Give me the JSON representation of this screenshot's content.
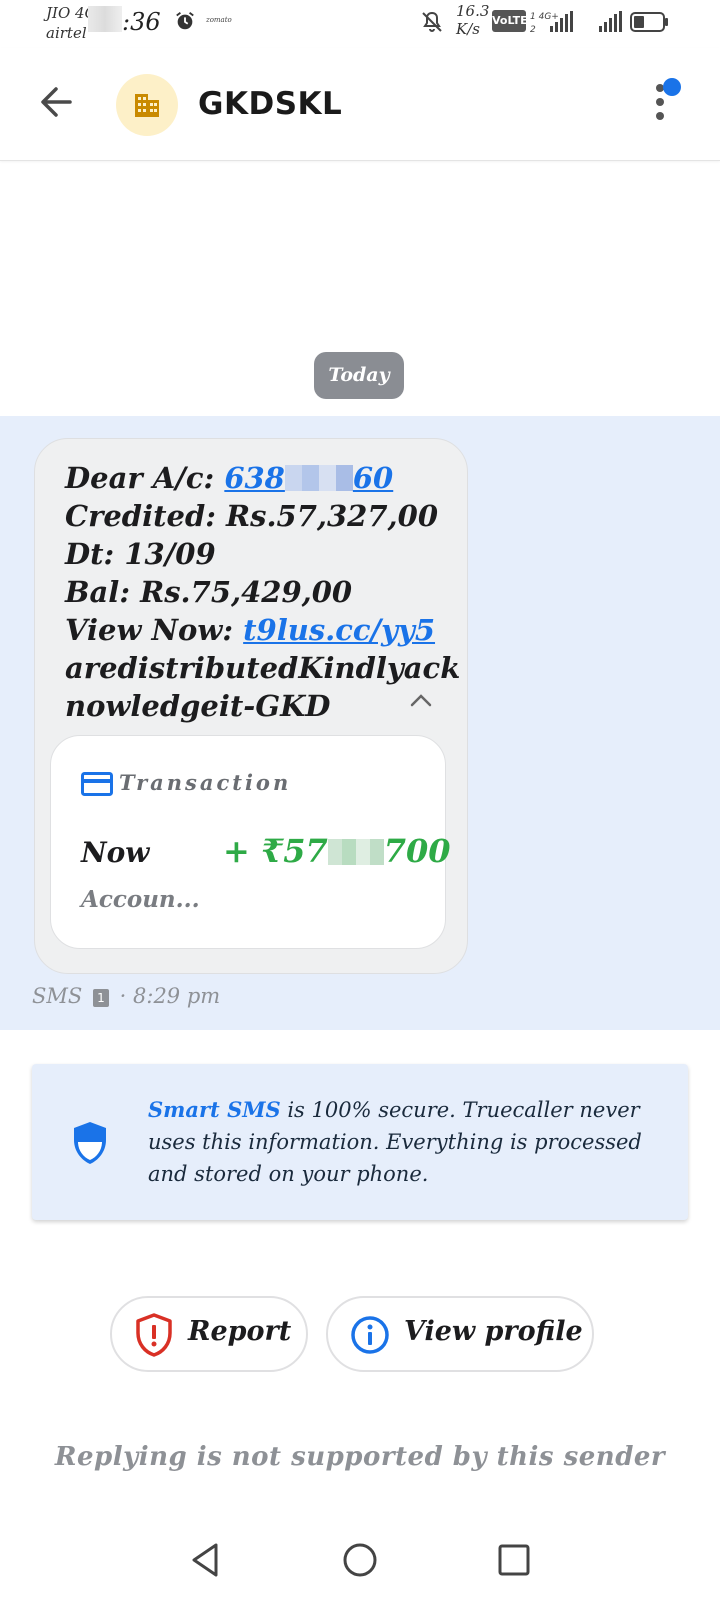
{
  "status_bar": {
    "carrier_primary": "JIO 4G",
    "carrier_secondary": "airtel",
    "time": ":36",
    "notification_app": "zomato",
    "speed_value": "16.3",
    "speed_unit": "K/s",
    "volte_label": "VoLTE",
    "icons": [
      "alarm-icon",
      "mute-icon",
      "signal-icon",
      "battery-icon"
    ]
  },
  "header": {
    "title": "GKDSKL",
    "avatar_icon": "building-icon",
    "accent_dot_color": "#1a73e8"
  },
  "date_chip": "Today",
  "message": {
    "line1_prefix": "Dear A/c: ",
    "account_start": "638",
    "account_end": "60",
    "line2": "Credited: Rs.57,327,00",
    "line3": "Dt: 13/09",
    "line4": "Bal: Rs.75,429,00",
    "line5_prefix": "View Now: ",
    "line5_link": "t9lus.cc/yy5",
    "line6": "aredistributedKindlyack",
    "line7": "nowledgeit-GKD",
    "meta_type": "SMS",
    "meta_sim": "1",
    "meta_time": "· 8:29 pm"
  },
  "transaction_card": {
    "title": "Transaction",
    "label": "Now",
    "amount_prefix": "+ ₹57",
    "amount_suffix": "700",
    "account": "Accoun...",
    "amount_color": "#2eaa46"
  },
  "notice": {
    "highlight": "Smart SMS",
    "text": " is 100% secure. Truecaller never uses this information. Everything is processed and stored on your phone."
  },
  "actions": {
    "report_label": "Report",
    "profile_label": "View profile"
  },
  "reply_note": "Replying is not supported by this sender",
  "colors": {
    "link": "#1a73e8",
    "message_area_bg": "#e6eefb",
    "report_icon": "#d93025"
  }
}
